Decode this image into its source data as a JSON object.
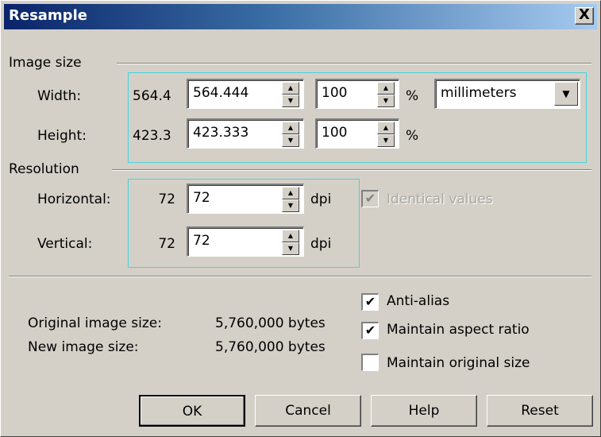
{
  "window": {
    "title": "Resample",
    "close_label": "X"
  },
  "image_size": {
    "group_label": "Image size",
    "width": {
      "label": "Width:",
      "original": "564.4",
      "value": "564.444",
      "percent": "100",
      "percent_sign": "%"
    },
    "height": {
      "label": "Height:",
      "original": "423.3",
      "value": "423.333",
      "percent": "100",
      "percent_sign": "%"
    },
    "units": "millimeters"
  },
  "resolution": {
    "group_label": "Resolution",
    "horizontal": {
      "label": "Horizontal:",
      "original": "72",
      "value": "72",
      "unit": "dpi"
    },
    "vertical": {
      "label": "Vertical:",
      "original": "72",
      "value": "72",
      "unit": "dpi"
    },
    "identical_values": {
      "label": "Identical values",
      "checked": true,
      "enabled": false
    }
  },
  "info": {
    "original_label": "Original image size:",
    "original_value": "5,760,000 bytes",
    "new_label": "New image size:",
    "new_value": "5,760,000 bytes"
  },
  "options": {
    "anti_alias": {
      "label": "Anti-alias",
      "checked": true
    },
    "maintain_aspect": {
      "label": "Maintain aspect ratio",
      "checked": true
    },
    "maintain_original": {
      "label": "Maintain original size",
      "checked": false
    }
  },
  "buttons": {
    "ok": "OK",
    "cancel": "Cancel",
    "help": "Help",
    "reset": "Reset"
  },
  "glyphs": {
    "check": "✔",
    "spin_up": "▲",
    "spin_down": "▼",
    "dropdown": "▼"
  }
}
